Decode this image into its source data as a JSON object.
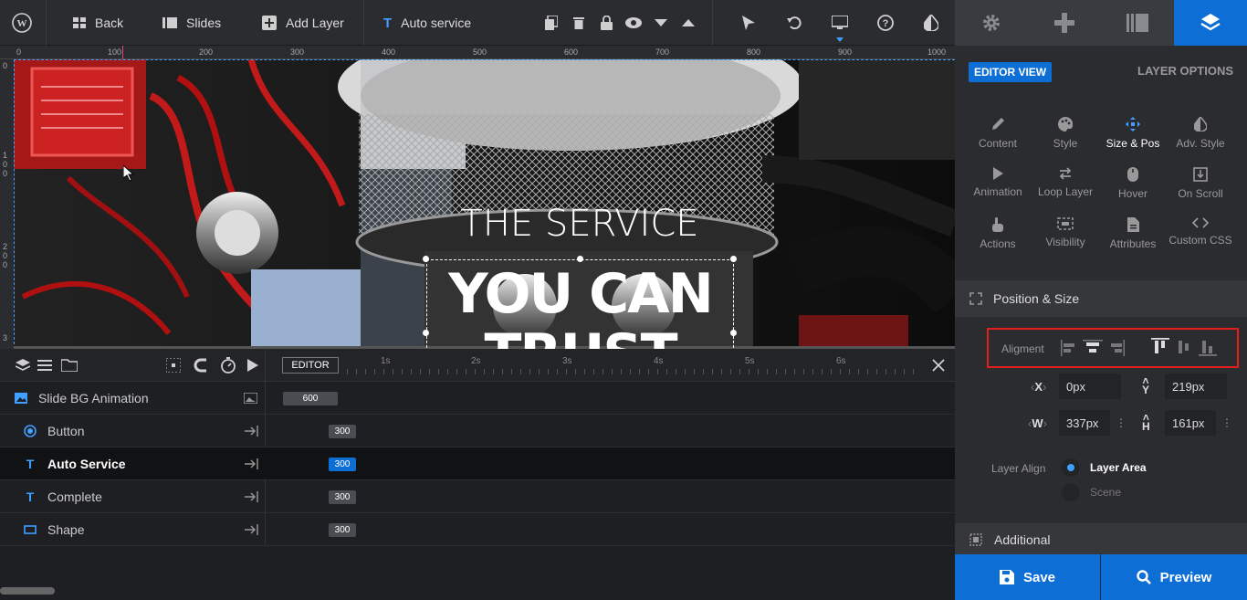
{
  "toolbar": {
    "back_label": "Back",
    "slides_label": "Slides",
    "add_layer_label": "Add Layer",
    "layer_name": "Auto service"
  },
  "ruler": {
    "ticks": [
      "0",
      "100",
      "200",
      "300",
      "400",
      "500",
      "600",
      "700",
      "800",
      "900",
      "1000"
    ]
  },
  "canvas": {
    "heading_light": "THE SERVICE",
    "heading_bold": "YOU CAN",
    "heading_bold_2": "TRUST"
  },
  "timeline": {
    "editor_label": "EDITOR",
    "seconds": [
      "1s",
      "2s",
      "3s",
      "4s",
      "5s",
      "6s"
    ],
    "rows": [
      {
        "name": "Slide BG Animation",
        "duration": "600"
      },
      {
        "name": "Button",
        "duration": "300"
      },
      {
        "name": "Auto Service",
        "duration": "300"
      },
      {
        "name": "Complete",
        "duration": "300"
      },
      {
        "name": "Shape",
        "duration": "300"
      }
    ]
  },
  "panel": {
    "editor_view": "EDITOR VIEW",
    "layer_options": "LAYER OPTIONS",
    "options": [
      {
        "label": "Content",
        "icon": "pencil-icon"
      },
      {
        "label": "Style",
        "icon": "palette-icon"
      },
      {
        "label": "Size & Pos",
        "icon": "move-icon"
      },
      {
        "label": "Adv. Style",
        "icon": "contrast-icon"
      },
      {
        "label": "Animation",
        "icon": "play-icon"
      },
      {
        "label": "Loop Layer",
        "icon": "loop-icon"
      },
      {
        "label": "Hover",
        "icon": "mouse-icon"
      },
      {
        "label": "On Scroll",
        "icon": "scroll-icon"
      },
      {
        "label": "Actions",
        "icon": "hand-icon"
      },
      {
        "label": "Visibility",
        "icon": "visibility-icon"
      },
      {
        "label": "Attributes",
        "icon": "document-icon"
      },
      {
        "label": "Custom CSS",
        "icon": "code-icon"
      }
    ],
    "section_position_size": "Position & Size",
    "alignment_label": "Aligment",
    "x_label": "X",
    "x_value": "0px",
    "y_label": "Y",
    "y_value": "219px",
    "w_label": "W",
    "w_value": "337px",
    "h_label": "H",
    "h_value": "161px",
    "layer_align_label": "Layer Align",
    "layer_area_label": "Layer Area",
    "scene_label": "Scene",
    "section_additional": "Additional",
    "save_label": "Save",
    "preview_label": "Preview"
  },
  "colors": {
    "accent": "#0d6fd6",
    "highlight_border": "#e51d1d"
  }
}
